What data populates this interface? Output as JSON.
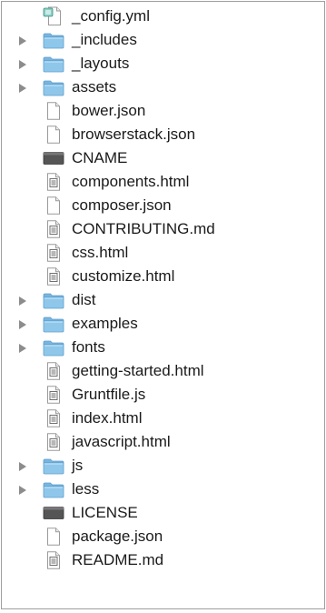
{
  "file_list": {
    "items": [
      {
        "label": "_config.yml",
        "kind": "config",
        "expandable": false
      },
      {
        "label": "_includes",
        "kind": "folder",
        "expandable": true
      },
      {
        "label": "_layouts",
        "kind": "folder",
        "expandable": true
      },
      {
        "label": "assets",
        "kind": "folder",
        "expandable": true
      },
      {
        "label": "bower.json",
        "kind": "blank",
        "expandable": false
      },
      {
        "label": "browserstack.json",
        "kind": "blank",
        "expandable": false
      },
      {
        "label": "CNAME",
        "kind": "binary",
        "expandable": false
      },
      {
        "label": "components.html",
        "kind": "text",
        "expandable": false
      },
      {
        "label": "composer.json",
        "kind": "blank",
        "expandable": false
      },
      {
        "label": "CONTRIBUTING.md",
        "kind": "text",
        "expandable": false
      },
      {
        "label": "css.html",
        "kind": "text",
        "expandable": false
      },
      {
        "label": "customize.html",
        "kind": "text",
        "expandable": false
      },
      {
        "label": "dist",
        "kind": "folder",
        "expandable": true
      },
      {
        "label": "examples",
        "kind": "folder",
        "expandable": true
      },
      {
        "label": "fonts",
        "kind": "folder",
        "expandable": true
      },
      {
        "label": "getting-started.html",
        "kind": "text",
        "expandable": false
      },
      {
        "label": "Gruntfile.js",
        "kind": "text",
        "expandable": false
      },
      {
        "label": "index.html",
        "kind": "text",
        "expandable": false
      },
      {
        "label": "javascript.html",
        "kind": "text",
        "expandable": false
      },
      {
        "label": "js",
        "kind": "folder",
        "expandable": true
      },
      {
        "label": "less",
        "kind": "folder",
        "expandable": true
      },
      {
        "label": "LICENSE",
        "kind": "binary",
        "expandable": false
      },
      {
        "label": "package.json",
        "kind": "blank",
        "expandable": false
      },
      {
        "label": "README.md",
        "kind": "text",
        "expandable": false
      }
    ]
  },
  "icons": {
    "folder": "folder-icon",
    "blank": "document-icon",
    "text": "text-document-icon",
    "binary": "binary-file-icon",
    "config": "config-file-icon"
  },
  "colors": {
    "folder_body": "#8fc7eb",
    "folder_tab": "#78b5df",
    "disclosure": "#8c8c8c",
    "border": "#9f9f9f",
    "text": "#1a1a1a"
  }
}
